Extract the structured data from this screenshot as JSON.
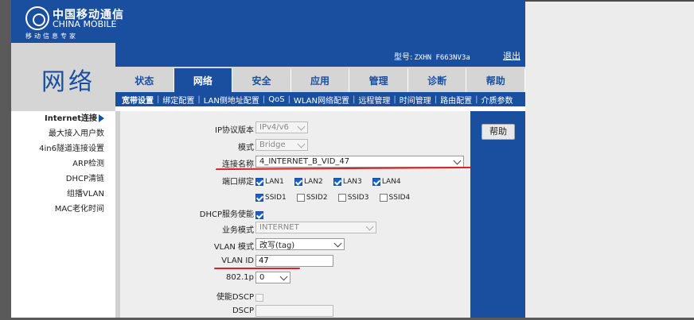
{
  "brand": {
    "cn": "中国移动通信",
    "en": "CHINA MOBILE",
    "slogan": "移动信息专家",
    "section_title": "网络"
  },
  "header": {
    "model_label": "型号:",
    "model_value": "ZXHN F663NV3a",
    "logout": "退出"
  },
  "tabs": [
    "状态",
    "网络",
    "安全",
    "应用",
    "管理",
    "诊断",
    "帮助"
  ],
  "active_tab": "网络",
  "subnav": [
    "宽带设置",
    "绑定配置",
    "LAN侧地址配置",
    "QoS",
    "WLAN网络配置",
    "远程管理",
    "时间管理",
    "路由配置",
    "介质参数"
  ],
  "sidebar": [
    "Internet连接",
    "最大接入用户数",
    "4in6隧道连接设置",
    "ARP检测",
    "DHCP清链",
    "组播VLAN",
    "MAC老化时间"
  ],
  "help_button": "帮助",
  "form": {
    "ip_version": {
      "label": "IP协议版本",
      "value": "IPv4/v6"
    },
    "mode": {
      "label": "模式",
      "value": "Bridge"
    },
    "conn_name": {
      "label": "连接名称",
      "value": "4_INTERNET_B_VID_47"
    },
    "port_bind": {
      "label": "端口绑定",
      "lan": [
        {
          "name": "LAN1",
          "checked": true
        },
        {
          "name": "LAN2",
          "checked": true
        },
        {
          "name": "LAN3",
          "checked": true
        },
        {
          "name": "LAN4",
          "checked": true
        }
      ],
      "ssid": [
        {
          "name": "SSID1",
          "checked": true
        },
        {
          "name": "SSID2",
          "checked": false
        },
        {
          "name": "SSID3",
          "checked": false
        },
        {
          "name": "SSID4",
          "checked": false
        }
      ]
    },
    "dhcp_enable": {
      "label": "DHCP服务使能",
      "checked": true
    },
    "service_mode": {
      "label": "业务模式",
      "value": "INTERNET"
    },
    "vlan_mode": {
      "label": "VLAN 模式",
      "value": "改写(tag)"
    },
    "vlan_id": {
      "label": "VLAN ID",
      "value": "47"
    },
    "p8021": {
      "label": "802.1p",
      "value": "0"
    },
    "dscp_enable": {
      "label": "使能DSCP"
    },
    "dscp": {
      "label": "DSCP",
      "value": ""
    }
  },
  "colors": {
    "brand_blue": "#1a4fa0",
    "annotation_red": "#e02020"
  }
}
